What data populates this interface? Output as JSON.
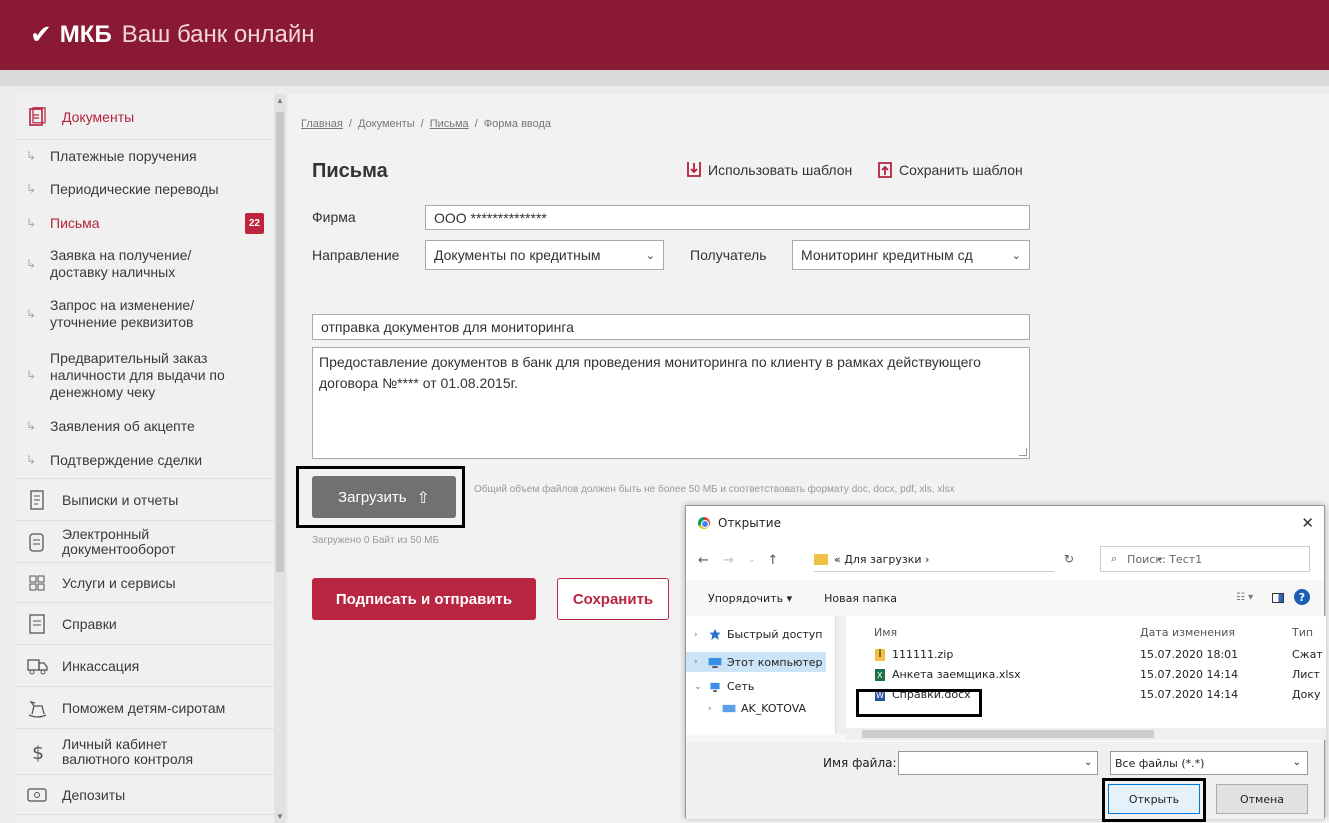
{
  "header": {
    "logo_mark": "✔",
    "logo_name": "МКБ",
    "logo_tagline": "Ваш банк онлайн"
  },
  "sidebar": {
    "sections": [
      {
        "label": "Документы",
        "icon": "documents-icon",
        "active": true
      },
      {
        "label": "Выписки и отчеты",
        "icon": "statement-icon"
      },
      {
        "label": "Электронный документооборот",
        "icon": "edo-icon"
      },
      {
        "label": "Услуги и сервисы",
        "icon": "services-grid-icon"
      },
      {
        "label": "Справки",
        "icon": "certificate-icon"
      },
      {
        "label": "Инкассация",
        "icon": "collection-truck-icon"
      },
      {
        "label": "Поможем детям-сиротам",
        "icon": "rocking-horse-icon"
      },
      {
        "label": "Личный кабинет валютного контроля",
        "icon": "dollar-icon"
      },
      {
        "label": "Депозиты",
        "icon": "deposit-icon"
      }
    ],
    "documents_items": [
      {
        "label": "Платежные поручения"
      },
      {
        "label": "Периодические переводы"
      },
      {
        "label": "Письма",
        "badge": "22",
        "active": true
      },
      {
        "label": "Заявка на получение/ доставку наличных"
      },
      {
        "label": "Запрос на изменение/ уточнение реквизитов"
      },
      {
        "label": "Предварительный заказ наличности для выдачи по денежному чеку"
      },
      {
        "label": "Заявления об акцепте"
      },
      {
        "label": "Подтверждение сделки"
      }
    ]
  },
  "breadcrumbs": [
    {
      "label": "Главная",
      "link": true
    },
    {
      "label": "Документы",
      "link": false
    },
    {
      "label": "Письма",
      "link": true
    },
    {
      "label": "Форма ввода",
      "link": false
    }
  ],
  "breadcrumb_separator": "/",
  "form": {
    "title": "Письма",
    "use_template": "Использовать шаблон",
    "save_template": "Сохранить шаблон",
    "firm_label": "Фирма",
    "firm_value": "ООО **************",
    "direction_label": "Направление",
    "direction_value": "Документы по кредитным",
    "recipient_label": "Получатель",
    "recipient_value": "Мониторинг кредитным сд",
    "subject_value": "отправка документов для мониторинга",
    "body_value": "Предоставление документов в банк для проведения мониторинга по клиенту в рамках действующего договора №**** от 01.08.2015г.",
    "upload_label": "Загрузить",
    "upload_hint": "Общий объем файлов должен быть не более 50 МБ и соответствовать формату doc, docx, pdf, xls, xlsx",
    "uploaded_status": "Загружено 0 Байт из 50 МБ",
    "sign_send_label": "Подписать и отправить",
    "save_label": "Сохранить"
  },
  "dialog": {
    "title": "Открытие",
    "path_prefix": "«",
    "path_folder": "Для загрузки",
    "path_sep": "›",
    "search_placeholder": "Поиск: Тест1",
    "organize_label": "Упорядочить ▾",
    "new_folder_label": "Новая папка",
    "tree": [
      {
        "label": "Быстрый доступ",
        "icon": "star-icon"
      },
      {
        "label": "Этот компьютер",
        "icon": "computer-icon",
        "selected": true
      },
      {
        "label": "Сеть",
        "icon": "network-icon"
      },
      {
        "label": "AK_KOTOVA",
        "icon": "monitor-icon"
      }
    ],
    "columns": {
      "name": "Имя",
      "date": "Дата изменения",
      "type": "Тип"
    },
    "files": [
      {
        "name": "111111.zip",
        "date": "15.07.2020 18:01",
        "type": "Сжат",
        "icon": "zip-icon"
      },
      {
        "name": "Анкета заемщика.xlsx",
        "date": "15.07.2020 14:14",
        "type": "Лист",
        "icon": "excel-icon"
      },
      {
        "name": "Справки.docx",
        "date": "15.07.2020 14:14",
        "type": "Доку",
        "icon": "word-icon"
      }
    ],
    "filename_label": "Имя файла:",
    "filename_value": "",
    "filetype_value": "Все файлы (*.*)",
    "open_label": "Открыть",
    "cancel_label": "Отмена"
  },
  "colors": {
    "brand": "#8a1a33",
    "accent": "#b82641",
    "badge": "#c0233d"
  }
}
